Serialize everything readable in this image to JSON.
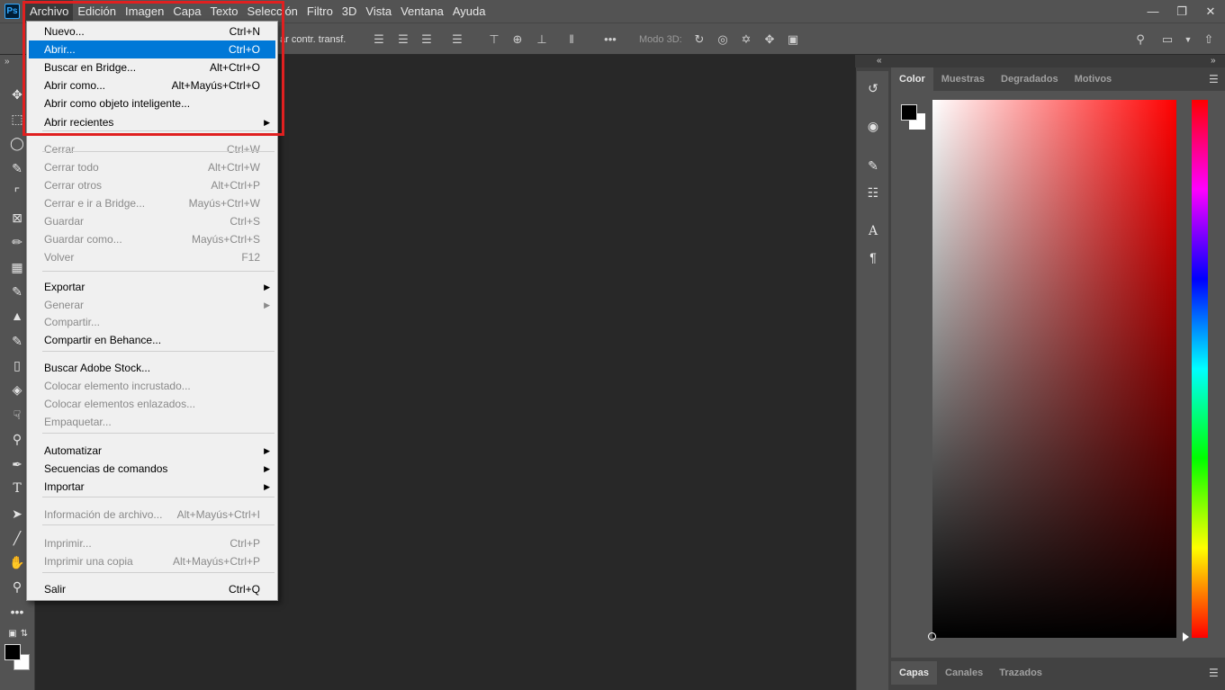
{
  "menubar": {
    "logo": "Ps",
    "items": [
      "Archivo",
      "Edición",
      "Imagen",
      "Capa",
      "Texto",
      "Selección",
      "Filtro",
      "3D",
      "Vista",
      "Ventana",
      "Ayuda"
    ],
    "window_controls": [
      "minimize-icon",
      "restore-icon",
      "close-icon"
    ]
  },
  "options": {
    "transform_text": "ar contr. transf.",
    "mode3d_label": "Modo 3D:"
  },
  "file_menu": {
    "items": [
      {
        "label": "Nuevo...",
        "shortcut": "Ctrl+N",
        "enabled": true
      },
      {
        "label": "Abrir...",
        "shortcut": "Ctrl+O",
        "enabled": true,
        "highlighted": true
      },
      {
        "label": "Buscar en Bridge...",
        "shortcut": "Alt+Ctrl+O",
        "enabled": true
      },
      {
        "label": "Abrir como...",
        "shortcut": "Alt+Mayús+Ctrl+O",
        "enabled": true
      },
      {
        "label": "Abrir como objeto inteligente...",
        "shortcut": "",
        "enabled": true
      },
      {
        "label": "Abrir recientes",
        "shortcut": "",
        "enabled": true,
        "submenu": true
      },
      {
        "label": "Cerrar",
        "shortcut": "Ctrl+W",
        "enabled": false
      },
      {
        "label": "Cerrar todo",
        "shortcut": "Alt+Ctrl+W",
        "enabled": false
      },
      {
        "label": "Cerrar otros",
        "shortcut": "Alt+Ctrl+P",
        "enabled": false
      },
      {
        "label": "Cerrar e ir a Bridge...",
        "shortcut": "Mayús+Ctrl+W",
        "enabled": false
      },
      {
        "label": "Guardar",
        "shortcut": "Ctrl+S",
        "enabled": false
      },
      {
        "label": "Guardar como...",
        "shortcut": "Mayús+Ctrl+S",
        "enabled": false
      },
      {
        "label": "Volver",
        "shortcut": "F12",
        "enabled": false
      },
      {
        "label": "Exportar",
        "shortcut": "",
        "enabled": true,
        "submenu": true
      },
      {
        "label": "Generar",
        "shortcut": "",
        "enabled": false,
        "submenu": true
      },
      {
        "label": "Compartir...",
        "shortcut": "",
        "enabled": false
      },
      {
        "label": "Compartir en Behance...",
        "shortcut": "",
        "enabled": true
      },
      {
        "label": "Buscar Adobe Stock...",
        "shortcut": "",
        "enabled": true
      },
      {
        "label": "Colocar elemento incrustado...",
        "shortcut": "",
        "enabled": false
      },
      {
        "label": "Colocar elementos enlazados...",
        "shortcut": "",
        "enabled": false
      },
      {
        "label": "Empaquetar...",
        "shortcut": "",
        "enabled": false
      },
      {
        "label": "Automatizar",
        "shortcut": "",
        "enabled": true,
        "submenu": true
      },
      {
        "label": "Secuencias de comandos",
        "shortcut": "",
        "enabled": true,
        "submenu": true
      },
      {
        "label": "Importar",
        "shortcut": "",
        "enabled": true,
        "submenu": true
      },
      {
        "label": "Información de archivo...",
        "shortcut": "Alt+Mayús+Ctrl+I",
        "enabled": false
      },
      {
        "label": "Imprimir...",
        "shortcut": "Ctrl+P",
        "enabled": false
      },
      {
        "label": "Imprimir una copia",
        "shortcut": "Alt+Mayús+Ctrl+P",
        "enabled": false
      },
      {
        "label": "Salir",
        "shortcut": "Ctrl+Q",
        "enabled": true
      }
    ]
  },
  "color_panel": {
    "tabs": [
      "Color",
      "Muestras",
      "Degradados",
      "Motivos"
    ],
    "active_tab": "Color",
    "foreground": "#000000",
    "background": "#ffffff",
    "hue_color": "#ff0000"
  },
  "layers_panel": {
    "tabs": [
      "Capas",
      "Canales",
      "Trazados"
    ],
    "active_tab": "Capas"
  },
  "colors": {
    "chrome": "#535353",
    "canvas": "#282828",
    "highlight": "#0078d7",
    "annotation": "#e02020"
  }
}
